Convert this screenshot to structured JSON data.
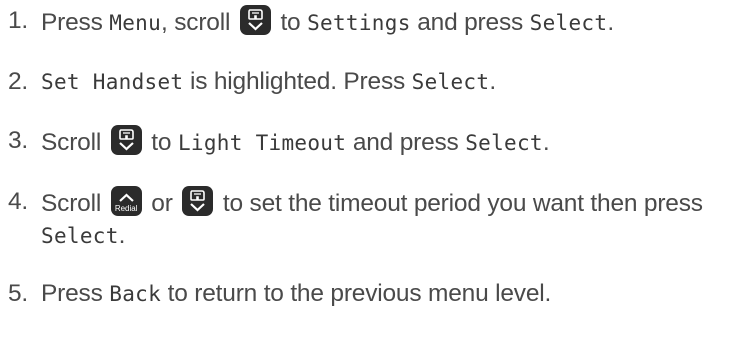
{
  "steps": [
    {
      "num": "1.",
      "parts": [
        "Press",
        "Menu",
        ", scroll",
        "to",
        "Settings",
        "and press",
        "Select",
        "."
      ]
    },
    {
      "num": "2.",
      "parts": [
        "Set Handset",
        "is highlighted. Press",
        "Select",
        "."
      ]
    },
    {
      "num": "3.",
      "parts": [
        "Scroll",
        "to",
        "Light Timeout",
        "and press",
        "Select",
        "."
      ]
    },
    {
      "num": "4.",
      "parts": [
        "Scroll",
        "or",
        "to set the timeout period you want then press",
        "Select",
        "."
      ]
    },
    {
      "num": "5.",
      "parts": [
        "Press",
        "Back",
        "to return to the previous menu level."
      ]
    }
  ],
  "keys": {
    "redial_label": "Redial",
    "down_icon": "phonebook-down-key-icon",
    "up_icon": "redial-up-key-icon"
  }
}
